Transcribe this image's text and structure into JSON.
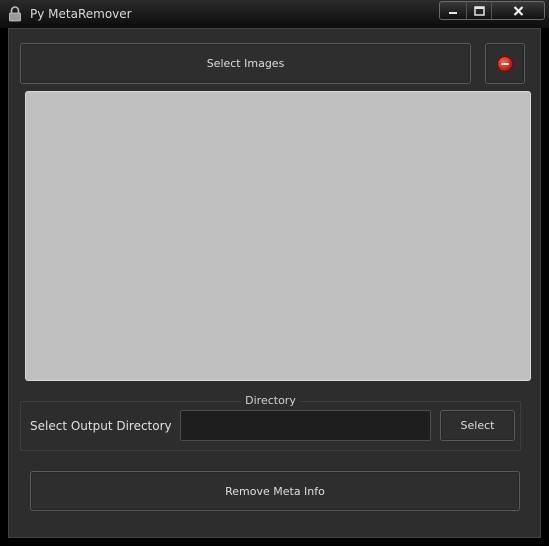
{
  "window": {
    "title": "Py MetaRemover"
  },
  "titlebar_icons": {
    "app": "lock-icon",
    "minimize": "minimize-icon",
    "maximize": "maximize-icon",
    "close": "close-icon"
  },
  "toolbar": {
    "select_images_label": "Select Images",
    "clear_icon": "remove-circle-icon"
  },
  "image_list": {
    "items": []
  },
  "directory": {
    "group_title": "Directory",
    "label": "Select Output Directory",
    "value": "",
    "select_label": "Select"
  },
  "actions": {
    "remove_meta_label": "Remove Meta Info"
  },
  "colors": {
    "clear_button_red": "#d21d12",
    "list_background": "#c0c0c0",
    "panel_background": "#2d2d2d"
  }
}
